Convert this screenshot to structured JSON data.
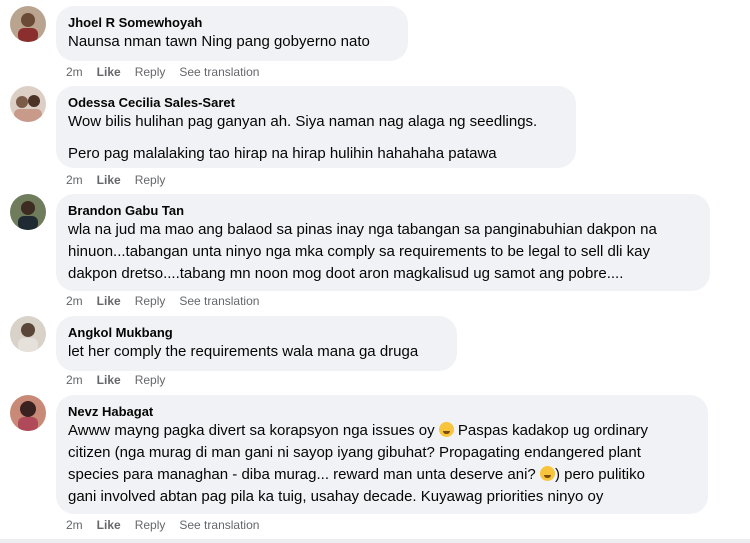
{
  "comments": [
    {
      "author": "Jhoel R Somewhoyah",
      "p1": "Naunsa nman tawn Ning pang gobyerno nato",
      "time": "2m",
      "like": "Like",
      "reply": "Reply",
      "translate": "See translation"
    },
    {
      "author": "Odessa Cecilia Sales-Saret",
      "p1": "Wow bilis hulihan pag ganyan ah. Siya naman nag alaga ng seedlings.",
      "p2": "Pero pag malalaking tao hirap na hirap hulihin hahahaha patawa",
      "time": "2m",
      "like": "Like",
      "reply": "Reply"
    },
    {
      "author": "Brandon Gabu Tan",
      "l1": "wla na jud ma mao ang balaod sa pinas inay nga tabangan sa panginabuhian dakpon na",
      "l2": "hinuon...tabangan unta ninyo nga mka comply sa requirements to be legal to sell dli kay",
      "l3": "dakpon dretso....tabang mn noon mog doot aron magkalisud ug samot ang pobre....",
      "time": "2m",
      "like": "Like",
      "reply": "Reply",
      "translate": "See translation"
    },
    {
      "author": "Angkol Mukbang",
      "p1": "let her comply the requirements wala mana ga druga",
      "time": "2m",
      "like": "Like",
      "reply": "Reply"
    },
    {
      "author": "Nevz Habagat",
      "l1a": "Awww mayng pagka divert sa korapsyon nga issues oy ",
      "l1b": " Paspas kadakop ug ordinary",
      "l2": "citizen (nga murag di man gani ni sayop iyang gibuhat? Propagating endangered plant",
      "l3a": "species para managhan - diba murag... reward man unta deserve ani? ",
      "l3b": ") pero pulitiko",
      "l4": "gani involved abtan pag pila ka tuig, usahay decade. Kuyawag priorities ninyo oy",
      "time": "2m",
      "like": "Like",
      "reply": "Reply",
      "translate": "See translation"
    }
  ]
}
